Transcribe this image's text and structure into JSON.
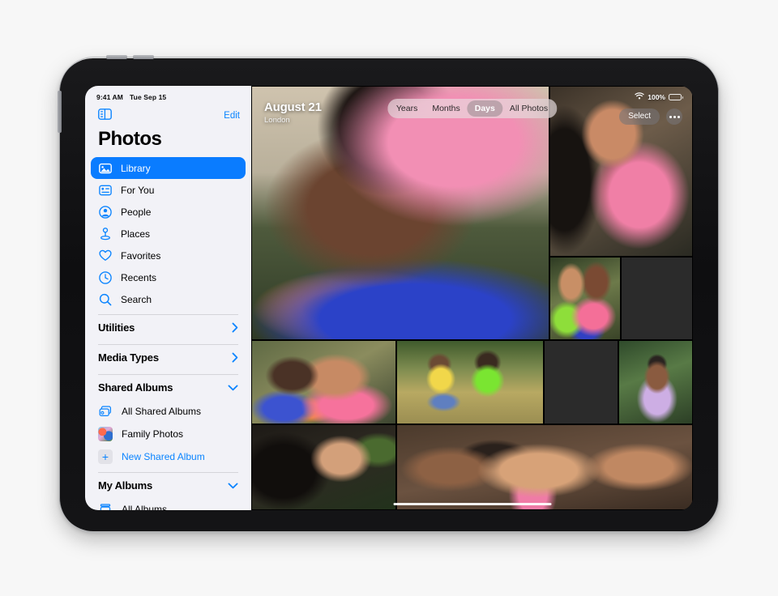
{
  "device": {
    "name": "iPad Air",
    "buttons": [
      "volume-up",
      "volume-down",
      "power"
    ]
  },
  "status_bar": {
    "time": "9:41 AM",
    "date": "Tue Sep 15",
    "wifi_icon": "wifi-icon",
    "battery_percent": "100%"
  },
  "sidebar": {
    "toggle_icon": "sidebar-toggle-icon",
    "edit_label": "Edit",
    "title": "Photos",
    "nav_items": [
      {
        "label": "Library",
        "icon": "photos-library-icon",
        "selected": true
      },
      {
        "label": "For You",
        "icon": "for-you-icon",
        "selected": false
      },
      {
        "label": "People",
        "icon": "person-circle-icon",
        "selected": false
      },
      {
        "label": "Places",
        "icon": "map-pin-icon",
        "selected": false
      },
      {
        "label": "Favorites",
        "icon": "heart-icon",
        "selected": false
      },
      {
        "label": "Recents",
        "icon": "clock-icon",
        "selected": false
      },
      {
        "label": "Search",
        "icon": "search-icon",
        "selected": false
      }
    ],
    "sections": [
      {
        "title": "Utilities",
        "chevron": "chevron-right-icon"
      },
      {
        "title": "Media Types",
        "chevron": "chevron-right-icon"
      },
      {
        "title": "Shared Albums",
        "chevron": "chevron-down-icon"
      }
    ],
    "shared_albums": [
      {
        "label": "All Shared Albums",
        "icon": "shared-album-icon",
        "accent": false
      },
      {
        "label": "Family Photos",
        "icon": "album-thumbnail",
        "accent": false
      },
      {
        "label": "New Shared Album",
        "icon": "plus-icon",
        "accent": true
      }
    ],
    "my_albums_section": {
      "title": "My Albums",
      "chevron": "chevron-down-icon"
    },
    "my_albums": [
      {
        "label": "All Albums",
        "icon": "albums-stack-icon",
        "accent": false
      }
    ]
  },
  "content": {
    "hero": {
      "date": "August 21",
      "location": "London"
    },
    "segmented_control": {
      "options": [
        "Years",
        "Months",
        "Days",
        "All Photos"
      ],
      "selected": "Days"
    },
    "select_label": "Select",
    "more_icon": "ellipsis-icon",
    "photos": [
      {
        "name": "woman-pink-hijab-profile",
        "art": "ph-hero"
      },
      {
        "name": "mother-daughter-portrait",
        "art": "ph-girl-top"
      },
      {
        "name": "two-women-pink-hijab",
        "art": "ph-two-green"
      },
      {
        "name": "woman-floral-dress-field",
        "art": "ph-field-dress"
      },
      {
        "name": "two-women-embrace",
        "art": "ph-couple-kiss"
      },
      {
        "name": "two-girls-sitting-grass",
        "art": "ph-two-sitting"
      },
      {
        "name": "berries-on-blanket",
        "art": "ph-berries"
      },
      {
        "name": "woman-lilac-hijab",
        "art": "ph-lilac"
      },
      {
        "name": "girl-curly-hair-smiling",
        "art": "ph-smile-curls"
      },
      {
        "name": "three-women-kissing-cheeks",
        "art": "ph-three-kiss"
      }
    ]
  },
  "colors": {
    "accent": "#0a84ff",
    "selected_row": "#0a7cff",
    "sidebar_bg": "#f2f2f7",
    "page_bg": "#f7f7f7"
  }
}
